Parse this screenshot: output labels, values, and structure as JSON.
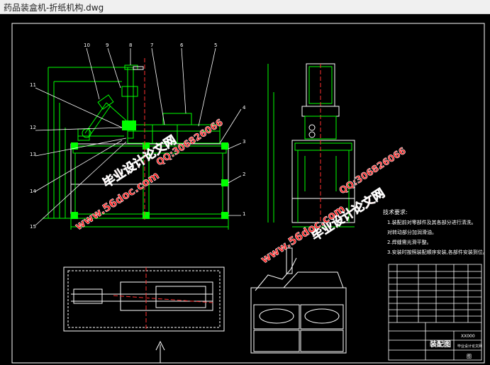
{
  "window": {
    "title": "药品装盒机-折纸机构.dwg"
  },
  "colors": {
    "background": "#000000",
    "green": "#00ff00",
    "white": "#ffffff",
    "red": "#ff3030",
    "yellow": "#ffff00",
    "watermark_red": "#ff1a1a"
  },
  "side_view": {
    "labels": [
      "10",
      "9",
      "8",
      "7",
      "6",
      "5",
      "4",
      "3",
      "2",
      "1",
      "11",
      "12",
      "13",
      "14",
      "15"
    ]
  },
  "notes": {
    "heading": "技术要求:",
    "line1": "1.装配前对零部件及其各部分进行清洗。",
    "line2": "对转动部分加润滑油。",
    "line3": "2.焊缝需光滑平整。",
    "line4": "3.安装时按照装配顺序安装,各部件安装到位。"
  },
  "title_block": {
    "drawing_name": "装配图",
    "code": "XX000",
    "company": "毕业设计论文网",
    "sheet": "图"
  },
  "watermarks": {
    "brand": "毕业设计论文网",
    "url": "www.56doc.com",
    "qq": "QQ:306826066"
  }
}
